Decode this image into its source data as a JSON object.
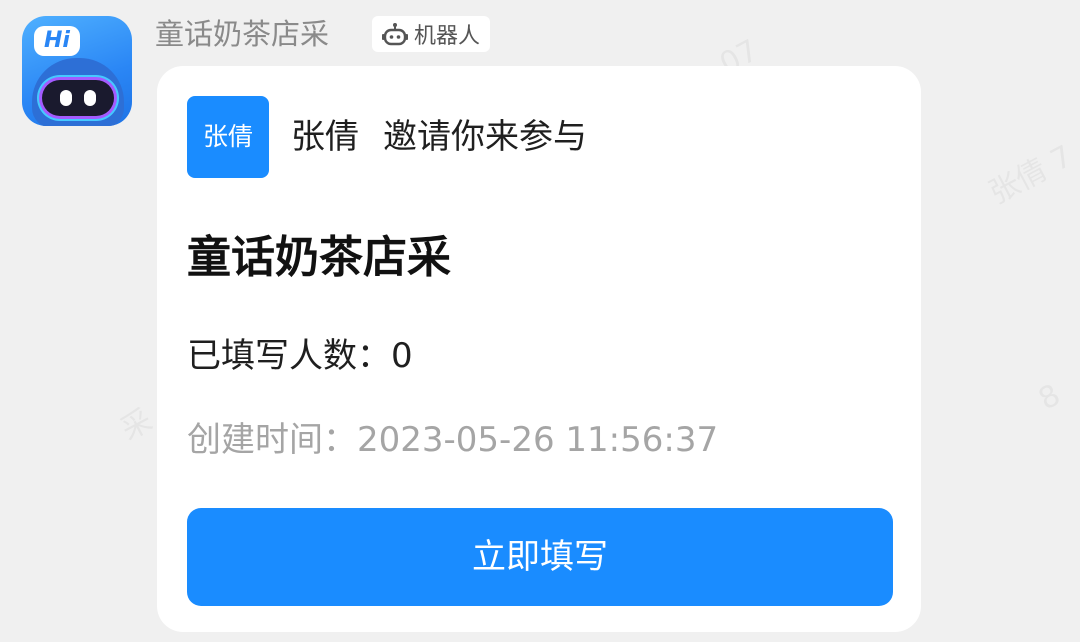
{
  "message": {
    "sender_name": "童话奶茶店采",
    "bot_tag": {
      "icon": "robot-icon",
      "label": "机器人"
    },
    "bot_avatar": {
      "badge_text": "Hi"
    }
  },
  "card": {
    "inviter": {
      "avatar_text": "张倩",
      "name": "张倩",
      "action": "邀请你来参与"
    },
    "title": "童话奶茶店采",
    "filled_count_label": "已填写人数：",
    "filled_count_value": "0",
    "created_time_label": "创建时间：",
    "created_time_value": "2023-05-26 11:56:37",
    "button_label": "立即填写"
  },
  "colors": {
    "accent": "#1a8cff",
    "background": "#f0f0f0",
    "card": "#ffffff"
  }
}
